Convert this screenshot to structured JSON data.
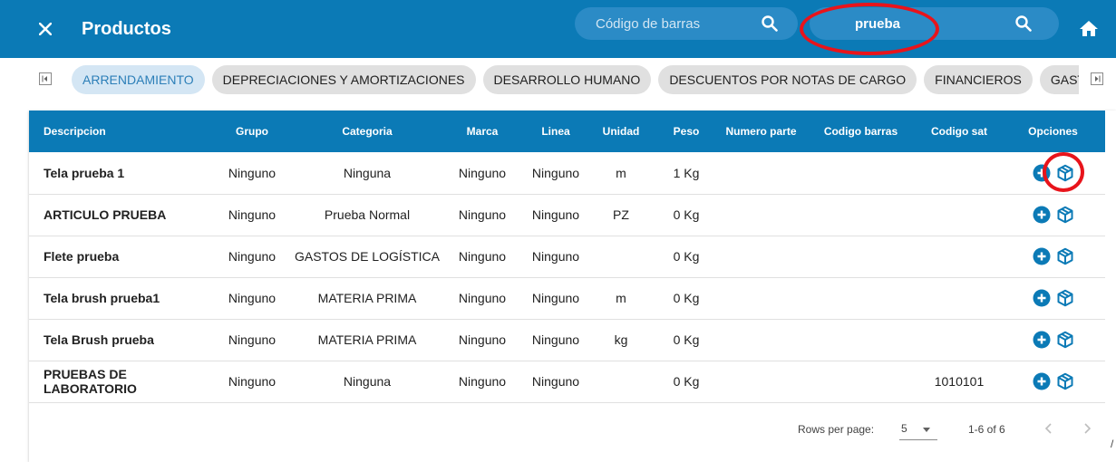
{
  "header": {
    "title": "Productos",
    "barcode_placeholder": "Código de barras",
    "barcode_value": "",
    "search_value": "prueba",
    "close_icon": "close-icon",
    "search_icon": "search-icon",
    "home_icon": "home-icon"
  },
  "chips": [
    "ARRENDAMIENTO",
    "DEPRECIACIONES Y AMORTIZACIONES",
    "DESARROLLO HUMANO",
    "DESCUENTOS POR NOTAS DE CARGO",
    "FINANCIEROS",
    "GASTOS COMERCIALES"
  ],
  "active_chip_index": 0,
  "table": {
    "columns": [
      "Descripcion",
      "Grupo",
      "Categoria",
      "Marca",
      "Linea",
      "Unidad",
      "Peso",
      "Numero parte",
      "Codigo barras",
      "Codigo sat",
      "Opciones"
    ],
    "rows": [
      [
        "Tela prueba 1",
        "Ninguno",
        "Ninguna",
        "Ninguno",
        "Ninguno",
        "m",
        "1 Kg",
        "",
        "",
        "",
        ""
      ],
      [
        "ARTICULO PRUEBA",
        "Ninguno",
        "Prueba Normal",
        "Ninguno",
        "Ninguno",
        "PZ",
        "0 Kg",
        "",
        "",
        "",
        ""
      ],
      [
        "Flete prueba",
        "Ninguno",
        "GASTOS DE LOGÍSTICA",
        "Ninguno",
        "Ninguno",
        "",
        "0 Kg",
        "",
        "",
        "",
        ""
      ],
      [
        "Tela brush prueba1",
        "Ninguno",
        "MATERIA PRIMA",
        "Ninguno",
        "Ninguno",
        "m",
        "0 Kg",
        "",
        "",
        "",
        ""
      ],
      [
        "Tela Brush prueba",
        "Ninguno",
        "MATERIA PRIMA",
        "Ninguno",
        "Ninguno",
        "kg",
        "0 Kg",
        "",
        "",
        "",
        ""
      ],
      [
        "PRUEBAS DE LABORATORIO",
        "Ninguno",
        "Ninguna",
        "Ninguno",
        "Ninguno",
        "",
        "0 Kg",
        "",
        "",
        "1010101",
        ""
      ]
    ]
  },
  "footer": {
    "rows_per_page_label": "Rows per page:",
    "rows_per_page_value": "5",
    "range": "1-6 of 6",
    "stray_mark": "/"
  },
  "colors": {
    "primary": "#0b7ab6",
    "annotation_red": "#e8141b",
    "active_chip_bg": "#d4e6f4",
    "active_chip_text": "#2c7fb8"
  }
}
